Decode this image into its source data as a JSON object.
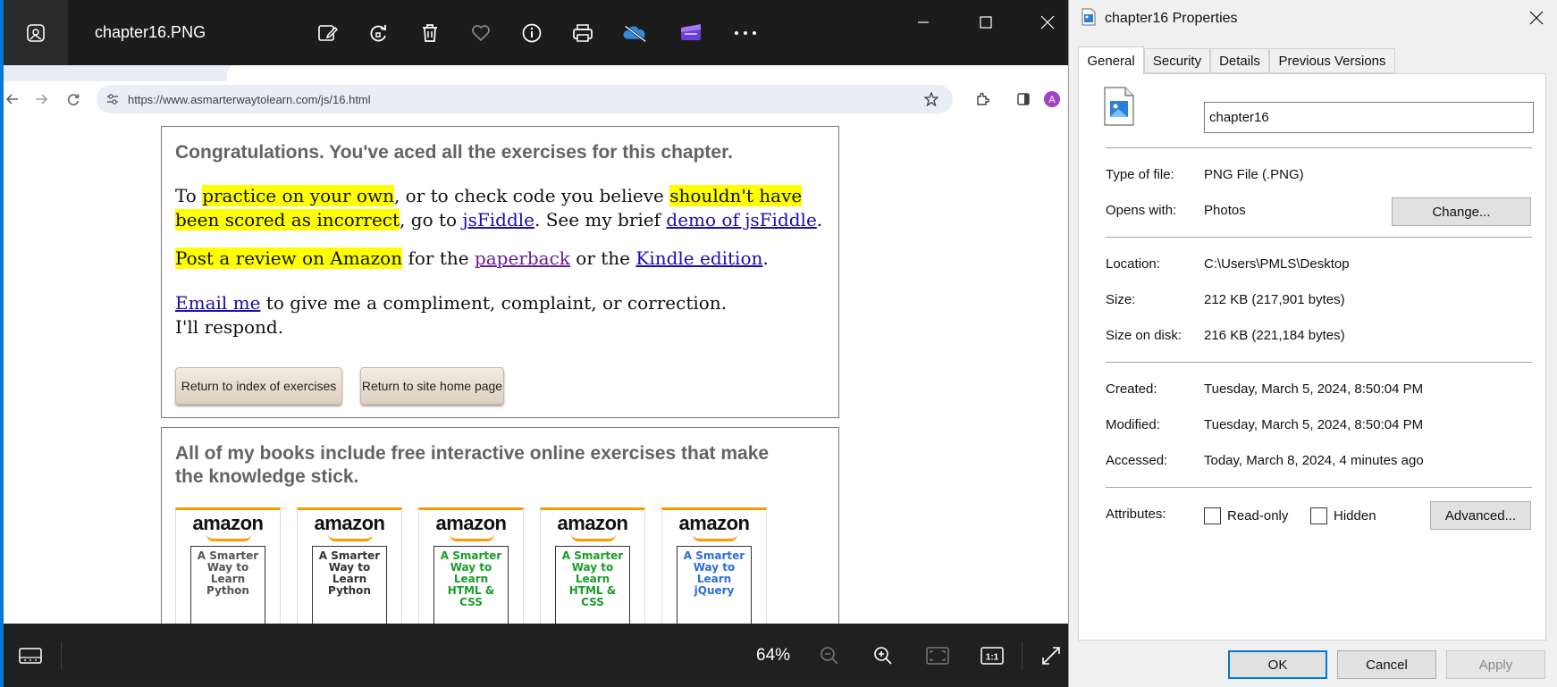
{
  "photos": {
    "title": "chapter16.PNG",
    "toolbar_icons": [
      "edit-image-icon",
      "rotate-icon",
      "delete-icon",
      "favorite-icon",
      "info-icon",
      "print-icon",
      "onedrive-icon",
      "clipchamp-icon",
      "more-icon"
    ],
    "zoom_level": "64%"
  },
  "browser": {
    "url": "https://www.asmarterwaytolearn.com/js/16.html"
  },
  "webpage": {
    "congrats_heading": "Congratulations. You've aced all the exercises for this chapter.",
    "p1": {
      "t1": "To ",
      "hl1": "practice on your own",
      "t2": ", or to check code you believe ",
      "hl2": "shouldn't have been scored as incorrect",
      "t3": ", go to ",
      "link1": "jsFiddle",
      "t4": ". See my brief ",
      "link2": "demo of jsFiddle",
      "t5": "."
    },
    "p2": {
      "hl": "Post a review on Amazon",
      "t1": " for the ",
      "link1": "paperback",
      "t2": " or the ",
      "link2": "Kindle edition",
      "t3": "."
    },
    "p3": {
      "link": "Email me",
      "t1": " to give me a compliment, complaint, or correction. I'll respond."
    },
    "buttons": {
      "index": "Return to index of exercises",
      "home": "Return to site home page"
    },
    "books_heading": "All of my books include free interactive online exercises that make the knowledge stick.",
    "books": [
      {
        "brand": "amazon",
        "line1": "A Smarter",
        "line2": "Way to",
        "line3": "Learn",
        "line4": "Python",
        "color": "#555555"
      },
      {
        "brand": "amazon",
        "line1": "A Smarter",
        "line2": "Way to",
        "line3": "Learn",
        "line4": "Python",
        "color": "#333333"
      },
      {
        "brand": "amazon",
        "line1": "A Smarter",
        "line2": "Way to",
        "line3": "Learn",
        "line4": "HTML & CSS",
        "color": "#1a9c2a"
      },
      {
        "brand": "amazon",
        "line1": "A Smarter",
        "line2": "Way to",
        "line3": "Learn",
        "line4": "HTML & CSS",
        "color": "#1a9c2a"
      },
      {
        "brand": "amazon",
        "line1": "A Smarter",
        "line2": "Way to",
        "line3": "Learn",
        "line4": "jQuery",
        "color": "#2a6fd6"
      }
    ]
  },
  "properties": {
    "title": "chapter16 Properties",
    "tabs": [
      "General",
      "Security",
      "Details",
      "Previous Versions"
    ],
    "filename": "chapter16",
    "type_label": "Type of file:",
    "type_value": "PNG File (.PNG)",
    "opens_label": "Opens with:",
    "opens_value": "Photos",
    "change_button": "Change...",
    "location_label": "Location:",
    "location_value": "C:\\Users\\PMLS\\Desktop",
    "size_label": "Size:",
    "size_value": "212 KB (217,901 bytes)",
    "size_disk_label": "Size on disk:",
    "size_disk_value": "216 KB (221,184 bytes)",
    "created_label": "Created:",
    "created_value": "Tuesday, March 5, 2024, 8:50:04 PM",
    "modified_label": "Modified:",
    "modified_value": "Tuesday, March 5, 2024, 8:50:04 PM",
    "accessed_label": "Accessed:",
    "accessed_value": "Today, March 8, 2024, 4 minutes ago",
    "attributes_label": "Attributes:",
    "readonly_label": "Read-only",
    "hidden_label": "Hidden",
    "advanced_button": "Advanced...",
    "ok_button": "OK",
    "cancel_button": "Cancel",
    "apply_button": "Apply"
  },
  "colors": {
    "accent": "#0078d4",
    "highlight": "#ffff00",
    "link": "#1a0dab",
    "visited_link": "#6a1b9a",
    "amazon_orange": "#ff9900"
  }
}
